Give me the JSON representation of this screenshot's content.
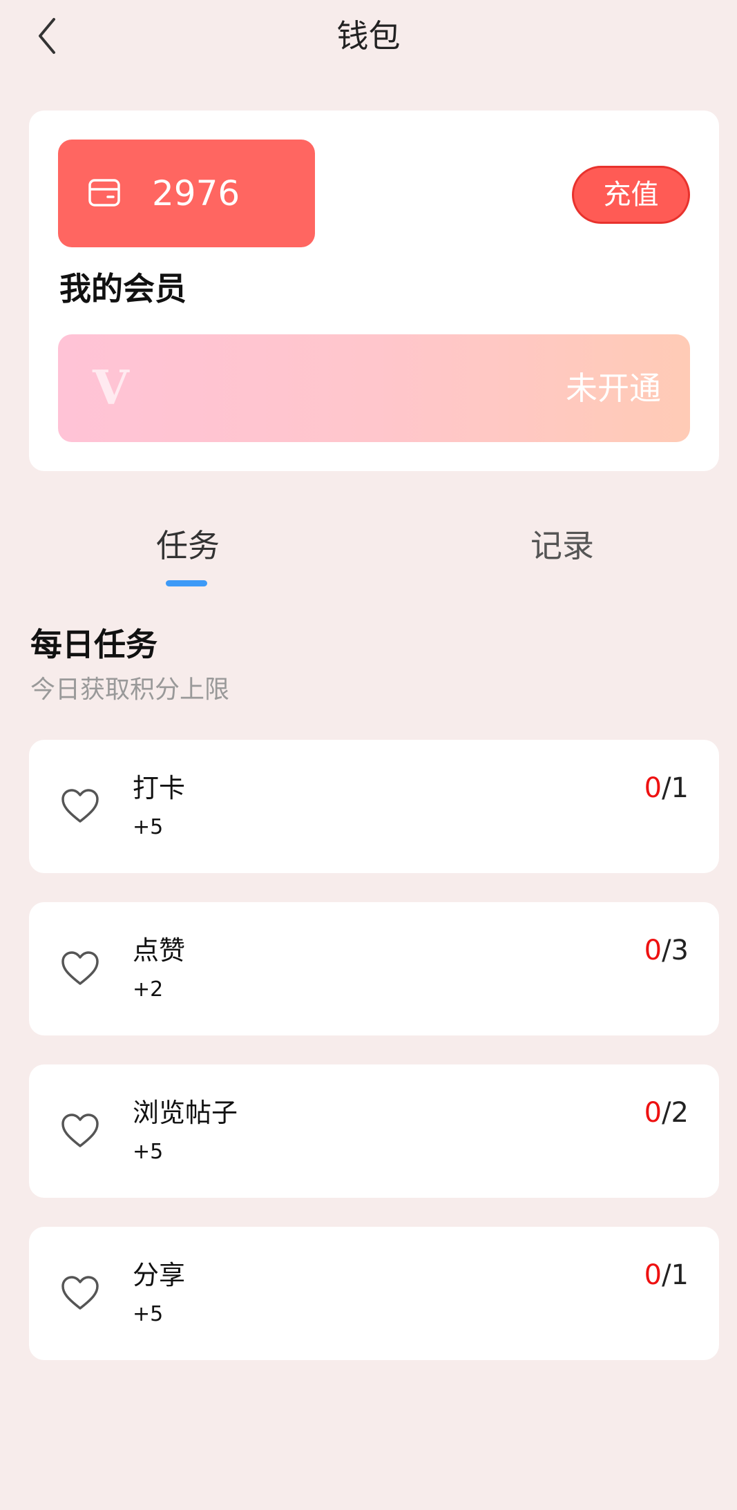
{
  "header": {
    "title": "钱包"
  },
  "wallet": {
    "balance": "2976",
    "recharge_label": "充值",
    "member_heading": "我的会员",
    "vip_mark": "V",
    "member_status": "未开通"
  },
  "tabs": [
    {
      "label": "任务",
      "active": true
    },
    {
      "label": "记录",
      "active": false
    }
  ],
  "daily": {
    "title": "每日任务",
    "subtitle": "今日获取积分上限",
    "tasks": [
      {
        "name": "打卡",
        "points": "+5",
        "done": "0",
        "total": "/1"
      },
      {
        "name": "点赞",
        "points": "+2",
        "done": "0",
        "total": "/3"
      },
      {
        "name": "浏览帖子",
        "points": "+5",
        "done": "0",
        "total": "/2"
      },
      {
        "name": "分享",
        "points": "+5",
        "done": "0",
        "total": "/1"
      }
    ]
  },
  "colors": {
    "background": "#f7eceb",
    "balance_box": "#ff6661",
    "recharge_button": "#ff5b55",
    "tab_indicator": "#3d9af7",
    "progress_done": "#ee1111"
  },
  "icons": {
    "back": "chevron-left-icon",
    "wallet": "wallet-card-icon",
    "task": "heart-outline-icon"
  }
}
